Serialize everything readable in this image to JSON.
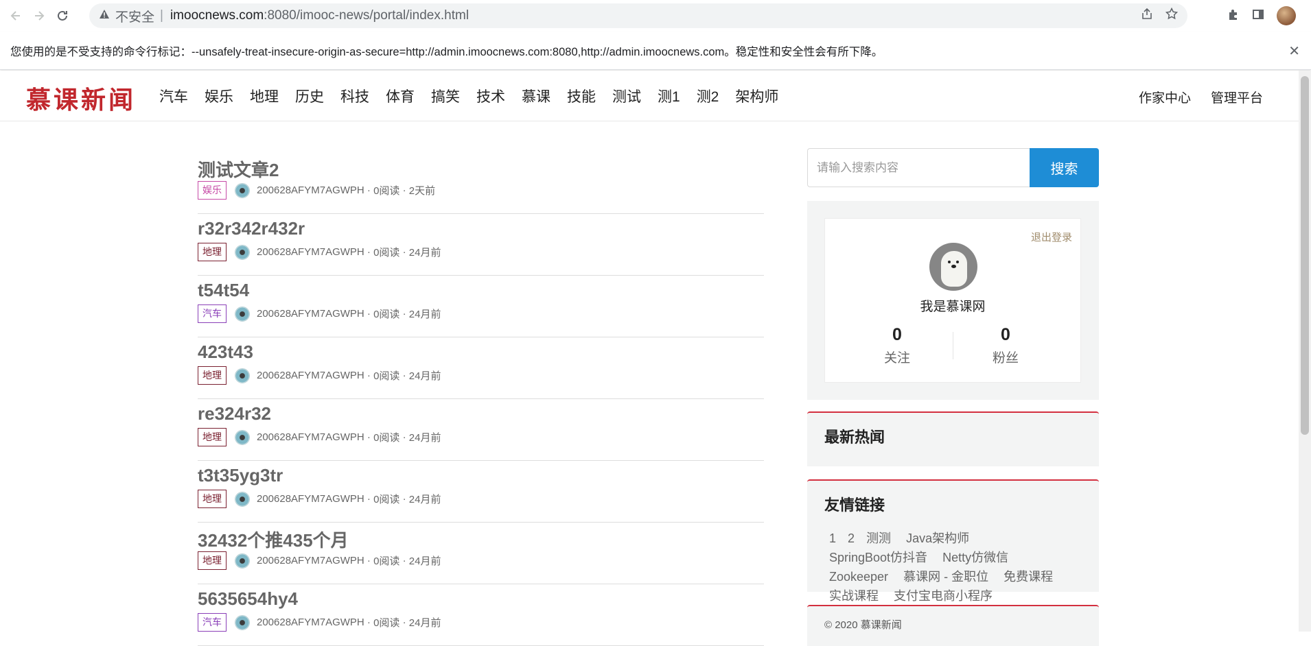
{
  "browser": {
    "security_label": "不安全",
    "url_host": "imoocnews.com",
    "url_rest": ":8080/imooc-news/portal/index.html",
    "infobar_text": "您使用的是不受支持的命令行标记：--unsafely-treat-insecure-origin-as-secure=http://admin.imoocnews.com:8080,http://admin.imoocnews.com。稳定性和安全性会有所下降。",
    "infobar_close": "✕"
  },
  "header": {
    "logo": "慕课新闻",
    "nav": [
      "汽车",
      "娱乐",
      "地理",
      "历史",
      "科技",
      "体育",
      "搞笑",
      "技术",
      "慕课",
      "技能",
      "测试",
      "测1",
      "测2",
      "架构师"
    ],
    "links": [
      "作家中心",
      "管理平台"
    ]
  },
  "articles": [
    {
      "title": "测试文章2",
      "tag": "娱乐",
      "tag_color": "#c64aa6",
      "author": "200628AFYM7AGWPH",
      "reads": "0阅读",
      "time": "2天前"
    },
    {
      "title": "r32r342r432r",
      "tag": "地理",
      "tag_color": "#7a2030",
      "author": "200628AFYM7AGWPH",
      "reads": "0阅读",
      "time": "24月前"
    },
    {
      "title": "t54t54",
      "tag": "汽车",
      "tag_color": "#8a3fb8",
      "author": "200628AFYM7AGWPH",
      "reads": "0阅读",
      "time": "24月前"
    },
    {
      "title": "423t43",
      "tag": "地理",
      "tag_color": "#7a2030",
      "author": "200628AFYM7AGWPH",
      "reads": "0阅读",
      "time": "24月前"
    },
    {
      "title": "re324r32",
      "tag": "地理",
      "tag_color": "#7a2030",
      "author": "200628AFYM7AGWPH",
      "reads": "0阅读",
      "time": "24月前"
    },
    {
      "title": "t3t35yg3tr",
      "tag": "地理",
      "tag_color": "#7a2030",
      "author": "200628AFYM7AGWPH",
      "reads": "0阅读",
      "time": "24月前"
    },
    {
      "title": "32432个推435个月",
      "tag": "地理",
      "tag_color": "#7a2030",
      "author": "200628AFYM7AGWPH",
      "reads": "0阅读",
      "time": "24月前"
    },
    {
      "title": "5635654hy4",
      "tag": "汽车",
      "tag_color": "#8a3fb8",
      "author": "200628AFYM7AGWPH",
      "reads": "0阅读",
      "time": "24月前"
    }
  ],
  "sidebar": {
    "search_placeholder": "请输入搜索内容",
    "search_button": "搜索",
    "logout": "退出登录",
    "username": "我是慕课网",
    "follow_count": "0",
    "follow_label": "关注",
    "fans_count": "0",
    "fans_label": "粉丝",
    "hot_title": "最新热闻",
    "links_title": "友情链接",
    "friend_links": [
      "1",
      "2",
      "测测",
      "Java架构师",
      "SpringBoot仿抖音",
      "Netty仿微信",
      "Zookeeper",
      "慕课网 - 金职位",
      "免费课程",
      "实战课程",
      "支付宝电商小程序"
    ],
    "copyright": "© 2020 慕课新闻"
  },
  "colors": {
    "accent_blue": "#1e8dd6",
    "accent_red": "#d32f3f",
    "logo_red": "#c1272d"
  }
}
